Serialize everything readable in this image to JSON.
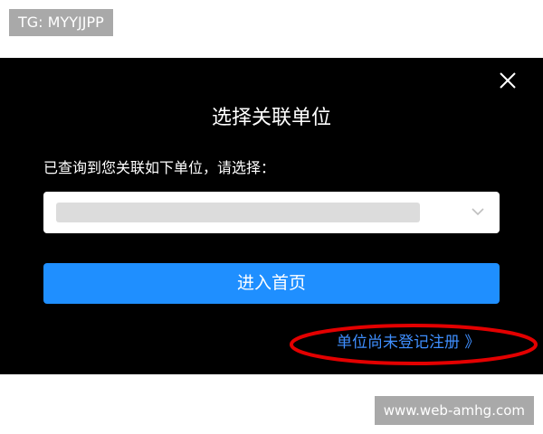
{
  "watermark": {
    "tag": "TG: MYYJJPP",
    "site": "www.web-amhg.com"
  },
  "modal": {
    "title": "选择关联单位",
    "prompt": "已查询到您关联如下单位，请选择：",
    "select": {
      "value": ""
    },
    "primary_button": "进入首页",
    "register_link": "单位尚未登记注册 》"
  },
  "colors": {
    "modal_background": "#000000",
    "primary": "#1f8fff",
    "link": "#3f8fff",
    "highlight": "#e30000",
    "badge": "#a9a9a9"
  },
  "icons": {
    "close": "close-icon",
    "dropdown": "chevron-down-icon"
  }
}
